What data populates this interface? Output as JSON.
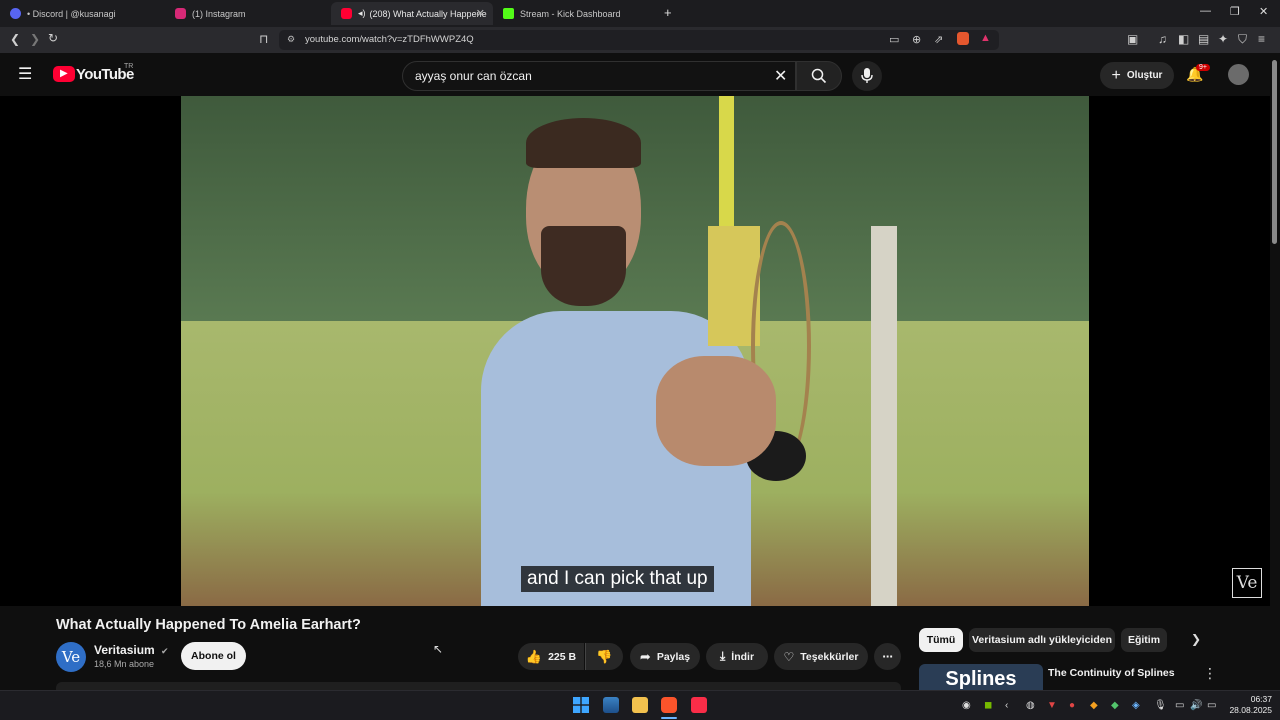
{
  "browser": {
    "tabs": [
      {
        "label": "• Discord | @kusanagi",
        "color": "#5865f2"
      },
      {
        "label": "(1) Instagram",
        "color": "#d62976"
      },
      {
        "label": "(208) What Actually Happene",
        "color": "#ff0033"
      },
      {
        "label": "Stream - Kick Dashboard",
        "color": "#53fc18"
      }
    ],
    "new_tab": "+",
    "url": "youtube.com/watch?v=zTDFhWWPZ4Q"
  },
  "youtube": {
    "logo": "YouTube",
    "region": "TR",
    "search_query": "ayyaş onur can özcan",
    "create_label": "Oluştur",
    "notif_badge": "9+"
  },
  "video": {
    "caption": "and I can pick that up",
    "watermark": "Ve",
    "title": "What Actually Happened To Amelia Earhart?"
  },
  "channel": {
    "avatar": "Ve",
    "name": "Veritasium",
    "subs": "18,6 Mn abone",
    "subscribe": "Abone ol"
  },
  "actions": {
    "likes": "225 B",
    "share": "Paylaş",
    "download": "İndir",
    "thanks": "Teşekkürler",
    "more": "⋯"
  },
  "chips": [
    "Tümü",
    "Veritasium adlı yükleyiciden",
    "Eğitim"
  ],
  "related": {
    "thumb_text": "Splines",
    "title": "The Continuity of Splines"
  },
  "taskbar": {
    "time": "06:37",
    "date": "28.08.2025"
  }
}
